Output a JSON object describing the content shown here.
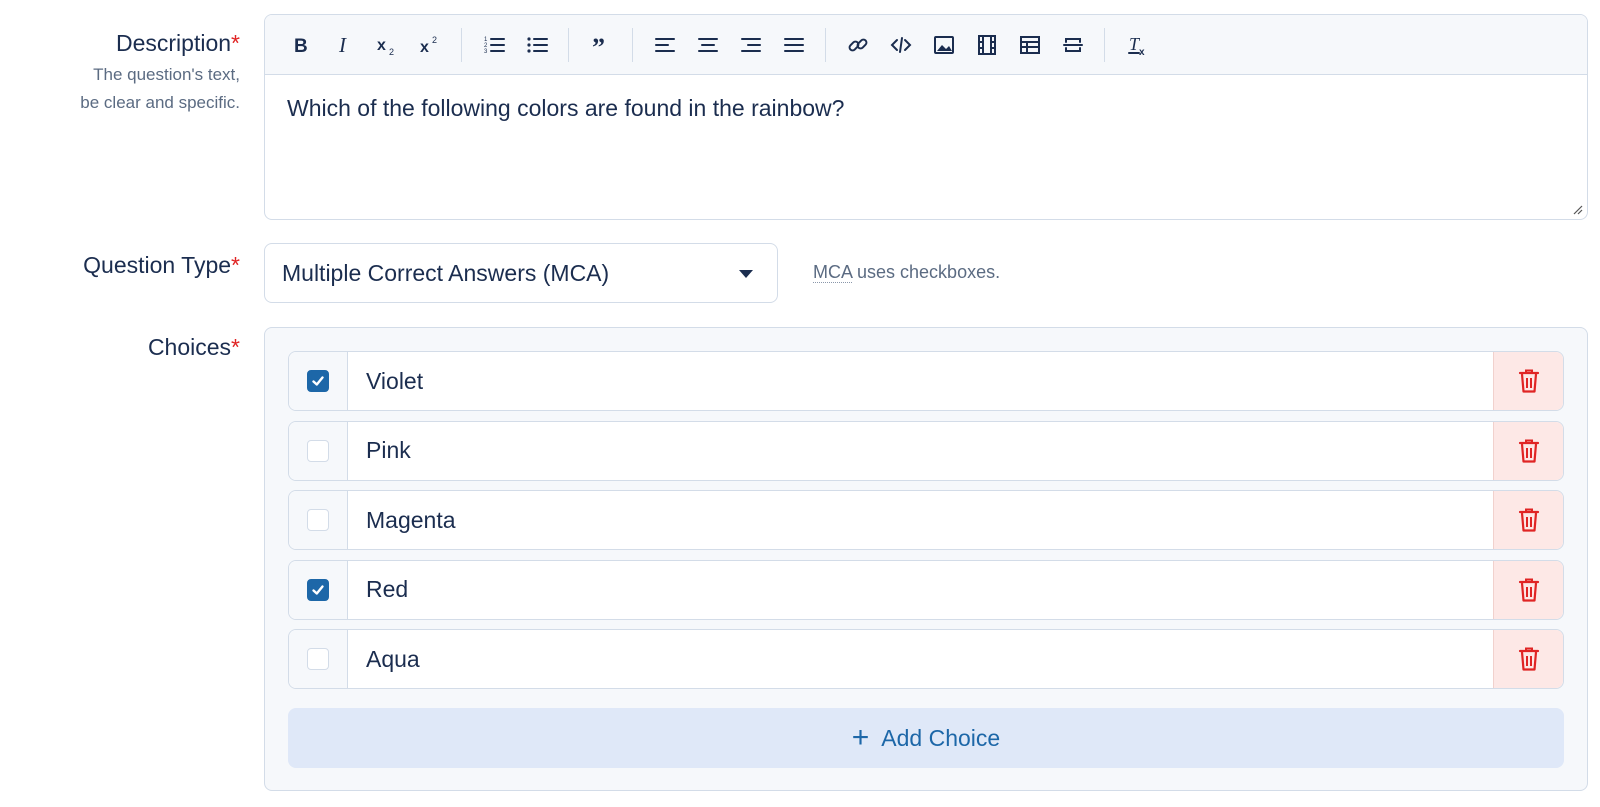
{
  "description": {
    "label": "Description",
    "required_mark": "*",
    "hint_line1": "The question's text,",
    "hint_line2": "be clear and specific.",
    "text": "Which of the following colors are found in the rainbow?",
    "toolbar": [
      [
        "bold",
        "italic",
        "subscript",
        "superscript"
      ],
      [
        "ordered-list",
        "bullet-list"
      ],
      [
        "blockquote"
      ],
      [
        "align-left",
        "align-center",
        "align-right",
        "align-justify"
      ],
      [
        "link",
        "code",
        "image",
        "video",
        "table",
        "horizontal-rule"
      ],
      [
        "clear-format"
      ]
    ]
  },
  "question_type": {
    "label": "Question Type",
    "required_mark": "*",
    "selected": "Multiple Correct Answers (MCA)",
    "hint_abbr": "MCA",
    "hint_rest": " uses checkboxes."
  },
  "choices": {
    "label": "Choices",
    "required_mark": "*",
    "items": [
      {
        "text": "Violet",
        "checked": true
      },
      {
        "text": "Pink",
        "checked": false
      },
      {
        "text": "Magenta",
        "checked": false
      },
      {
        "text": "Red",
        "checked": true
      },
      {
        "text": "Aqua",
        "checked": false
      }
    ],
    "add_label": "Add Choice"
  },
  "colors": {
    "accent": "#1d67a8",
    "danger": "#e02424",
    "danger_bg": "#fde8e6",
    "add_bg": "#dfe8f8"
  }
}
